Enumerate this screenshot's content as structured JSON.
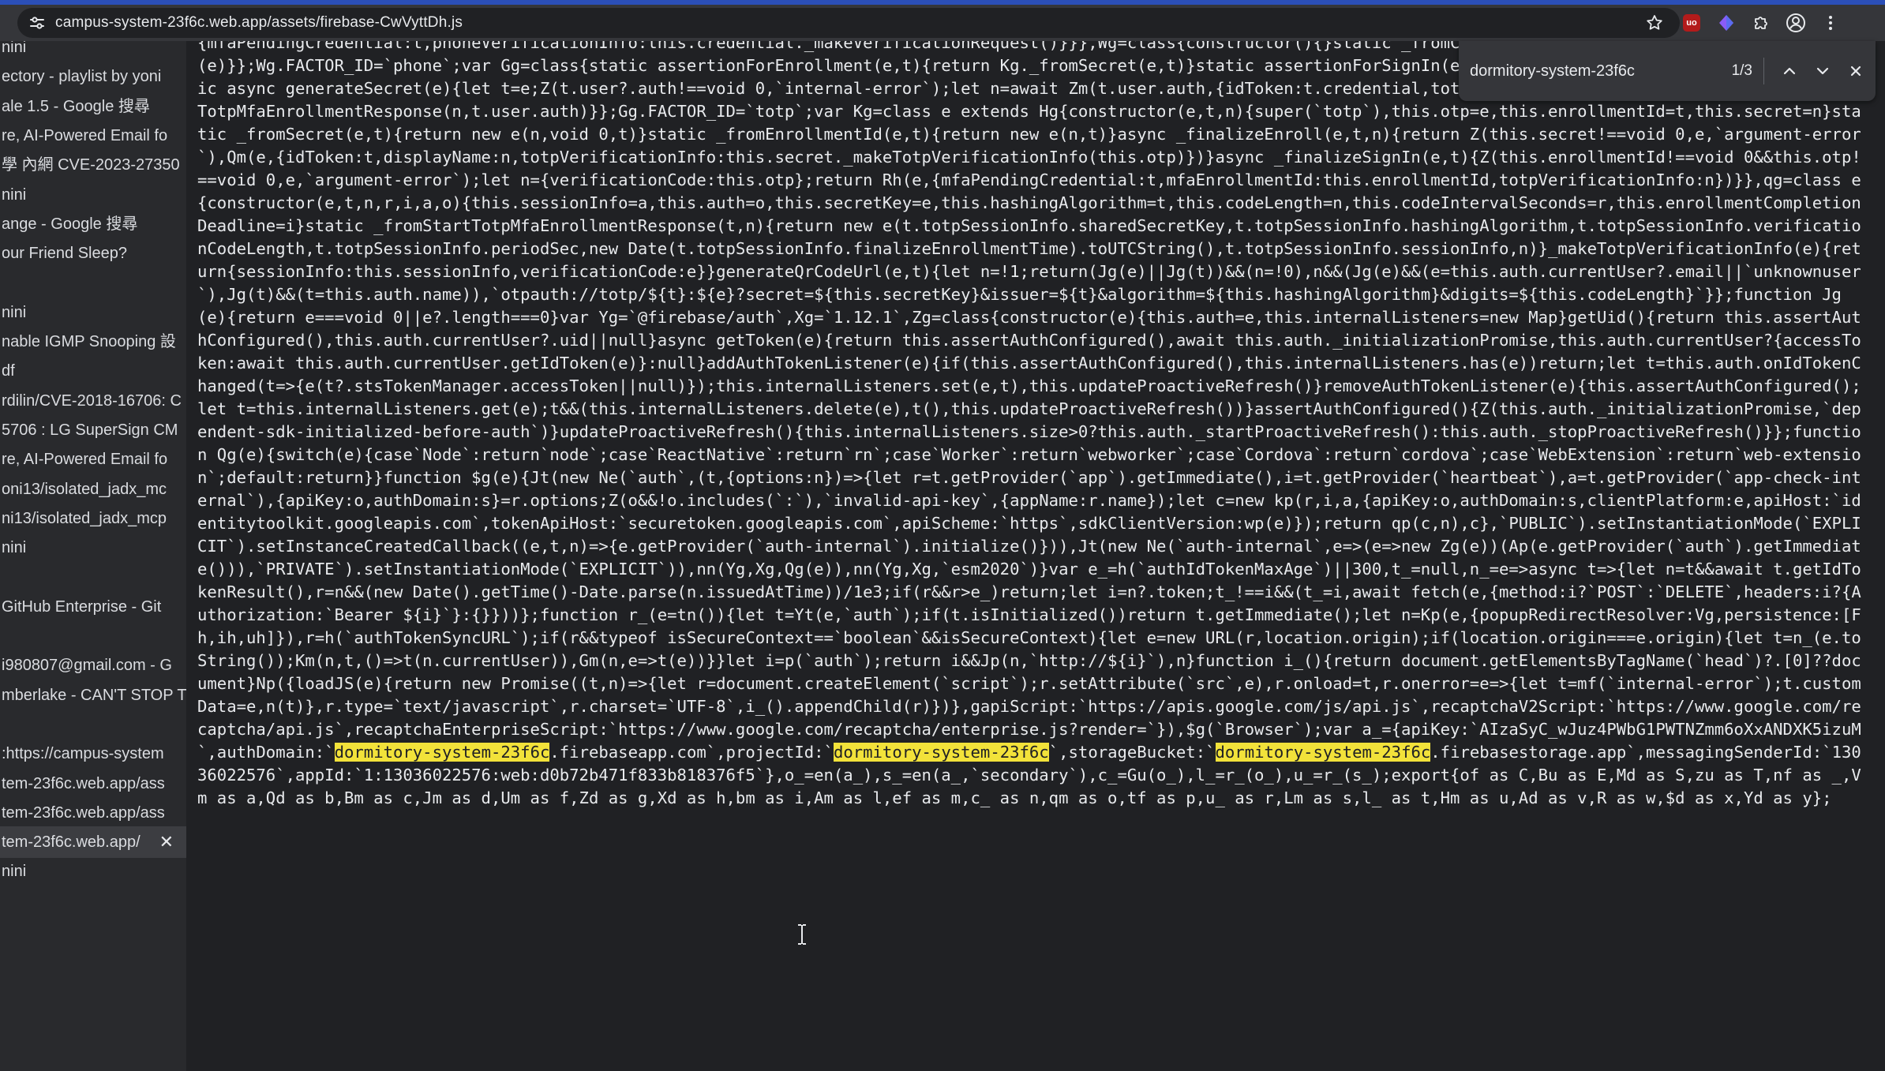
{
  "browser": {
    "url": "campus-system-23f6c.web.app/assets/firebase-CwVyttDh.js"
  },
  "find": {
    "query": "dormitory-system-23f6c",
    "count": "1/3"
  },
  "tabs": [
    {
      "label": "nini",
      "top": 0
    },
    {
      "label": "ectory - playlist by yoni",
      "top": 0
    },
    {
      "label": "ale 1.5 - Google 搜尋",
      "top": 0
    },
    {
      "label": "re, AI-Powered Email fo",
      "top": 0
    },
    {
      "label": "學 內網 CVE-2023-27350",
      "top": 0
    },
    {
      "label": "nini",
      "top": 0
    },
    {
      "label": "ange - Google 搜尋",
      "top": 0
    },
    {
      "label": "our Friend Sleep?",
      "top": 0
    },
    {
      "label": "",
      "top": 0
    },
    {
      "label": "nini",
      "top": 0
    },
    {
      "label": "nable IGMP Snooping 設",
      "top": 0
    },
    {
      "label": "df",
      "top": 0
    },
    {
      "label": "rdilin/CVE-2018-16706: C",
      "top": 0
    },
    {
      "label": "5706 : LG SuperSign CM",
      "top": 0
    },
    {
      "label": "re, AI-Powered Email fo",
      "top": 0
    },
    {
      "label": "oni13/isolated_jadx_mc",
      "top": 0
    },
    {
      "label": "ni13/isolated_jadx_mcp",
      "top": 0
    },
    {
      "label": "nini",
      "top": 0
    },
    {
      "label": "",
      "top": 0
    },
    {
      "label": " GitHub Enterprise - Git",
      "top": 0
    },
    {
      "label": "",
      "top": 0
    },
    {
      "label": "i980807@gmail.com - G",
      "top": 0
    },
    {
      "label": "mberlake - CAN'T STOP T",
      "top": 0
    },
    {
      "label": "",
      "top": 0
    },
    {
      "label": ":https://campus-system",
      "top": 0
    },
    {
      "label": "tem-23f6c.web.app/ass",
      "top": 0
    },
    {
      "label": "tem-23f6c.web.app/ass",
      "top": 0
    },
    {
      "label": "tem-23f6c.web.app/",
      "top": 0
    },
    {
      "label": "nini",
      "top": 0
    }
  ],
  "tab_close_glyph": "✕",
  "code": {
    "before": "{mfaPendingCredential:t,phoneVerificationInfo:this.credential._makeVerificationRequest()}}},Wg=class{constructor(){}static _fromCredential(e){return Ug._fromCredential(e)}};Wg.FACTOR_ID=`phone`;var Gg=class{static assertionForEnrollment(e,t){return Kg._fromSecret(e,t)}static assertionForSignIn(e,t){return Kg._fromEnrollmentId(e,t)}static async generateSecret(e){let t=e;Z(t.user?.auth!==void 0,`internal-error`);let n=await Zm(t.user.auth,{idToken:t.credential,totpEnrollmentInfo:{}});return qg._fromStartTotpMfaEnrollmentResponse(n,t.user.auth)}};Gg.FACTOR_ID=`totp`;var Kg=class e extends Hg{constructor(e,t,n){super(`totp`),this.otp=e,this.enrollmentId=t,this.secret=n}static _fromSecret(e,t){return new e(n,void 0,t)}static _fromEnrollmentId(e,t){return new e(n,t)}async _finalizeEnroll(e,t,n){return Z(this.secret!==void 0,e,`argument-error`),Qm(e,{idToken:t,displayName:n,totpVerificationInfo:this.secret._makeTotpVerificationInfo(this.otp)})}async _finalizeSignIn(e,t){Z(this.enrollmentId!==void 0&&this.otp!==void 0,e,`argument-error`);let n={verificationCode:this.otp};return Rh(e,{mfaPendingCredential:t,mfaEnrollmentId:this.enrollmentId,totpVerificationInfo:n})}},qg=class e{constructor(e,t,n,r,i,a,o){this.sessionInfo=a,this.auth=o,this.secretKey=e,this.hashingAlgorithm=t,this.codeLength=n,this.codeIntervalSeconds=r,this.enrollmentCompletionDeadline=i}static _fromStartTotpMfaEnrollmentResponse(t,n){return new e(t.totpSessionInfo.sharedSecretKey,t.totpSessionInfo.hashingAlgorithm,t.totpSessionInfo.verificationCodeLength,t.totpSessionInfo.periodSec,new Date(t.totpSessionInfo.finalizeEnrollmentTime).toUTCString(),t.totpSessionInfo.sessionInfo,n)}_makeTotpVerificationInfo(e){return{sessionInfo:this.sessionInfo,verificationCode:e}}generateQrCodeUrl(e,t){let n=!1;return(Jg(e)||Jg(t))&&(n=!0),n&&(Jg(e)&&(e=this.auth.currentUser?.email||`unknownuser`),Jg(t)&&(t=this.auth.name)),`otpauth://totp/${t}:${e}?secret=${this.secretKey}&issuer=${t}&algorithm=${this.hashingAlgorithm}&digits=${this.codeLength}`}};function Jg(e){return e===void 0||e?.length===0}var Yg=`@firebase/auth`,Xg=`1.12.1`,Zg=class{constructor(e){this.auth=e,this.internalListeners=new Map}getUid(){return this.assertAuthConfigured(),this.auth.currentUser?.uid||null}async getToken(e){return this.assertAuthConfigured(),await this.auth._initializationPromise,this.auth.currentUser?{accessToken:await this.auth.currentUser.getIdToken(e)}:null}addAuthTokenListener(e){if(this.assertAuthConfigured(),this.internalListeners.has(e))return;let t=this.auth.onIdTokenChanged(t=>{e(t?.stsTokenManager.accessToken||null)});this.internalListeners.set(e,t),this.updateProactiveRefresh()}removeAuthTokenListener(e){this.assertAuthConfigured();let t=this.internalListeners.get(e);t&&(this.internalListeners.delete(e),t(),this.updateProactiveRefresh())}assertAuthConfigured(){Z(this.auth._initializationPromise,`dependent-sdk-initialized-before-auth`)}updateProactiveRefresh(){this.internalListeners.size>0?this.auth._startProactiveRefresh():this.auth._stopProactiveRefresh()}};function Qg(e){switch(e){case`Node`:return`node`;case`ReactNative`:return`rn`;case`Worker`:return`webworker`;case`Cordova`:return`cordova`;case`WebExtension`:return`web-extension`;default:return}}function $g(e){Jt(new Ne(`auth`,(t,{options:n})=>{let r=t.getProvider(`app`).getImmediate(),i=t.getProvider(`heartbeat`),a=t.getProvider(`app-check-internal`),{apiKey:o,authDomain:s}=r.options;Z(o&&!o.includes(`:`),`invalid-api-key`,{appName:r.name});let c=new kp(r,i,a,{apiKey:o,authDomain:s,clientPlatform:e,apiHost:`identitytoolkit.googleapis.com`,tokenApiHost:`securetoken.googleapis.com`,apiScheme:`https`,sdkClientVersion:wp(e)});return qp(c,n),c},`PUBLIC`).setInstantiationMode(`EXPLICIT`).setInstanceCreatedCallback((e,t,n)=>{e.getProvider(`auth-internal`).initialize()})),Jt(new Ne(`auth-internal`,e=>(e=>new Zg(e))(Ap(e.getProvider(`auth`).getImmediate())),`PRIVATE`).setInstantiationMode(`EXPLICIT`)),nn(Yg,Xg,Qg(e)),nn(Yg,Xg,`esm2020`)}var e_=h(`authIdTokenMaxAge`)||300,t_=null,n_=e=>async t=>{let n=t&&await t.getIdTokenResult(),r=n&&(new Date().getTime()-Date.parse(n.issuedAtTime))/1e3;if(r&&r>e_)return;let i=n?.token;t_!==i&&(t_=i,await fetch(e,{method:i?`POST`:`DELETE`,headers:i?{Authorization:`Bearer ${i}`}:{}}))};function r_(e=tn()){let t=Yt(e,`auth`);if(t.isInitialized())return t.getImmediate();let n=Kp(e,{popupRedirectResolver:Vg,persistence:[Fh,ih,uh]}),r=h(`authTokenSyncURL`);if(r&&typeof isSecureContext==`boolean`&&isSecureContext){let e=new URL(r,location.origin);if(location.origin===e.origin){let t=n_(e.toString());Km(n,t,()=>t(n.currentUser)),Gm(n,e=>t(e))}}let i=p(`auth`);return i&&Jp(n,`http://${i}`),n}function i_(){return document.getElementsByTagName(`head`)?.[0]??document}Np({loadJS(e){return new Promise((t,n)=>{let r=document.createElement(`script`);r.setAttribute(`src`,e),r.onload=t,r.onerror=e=>{let t=mf(`internal-error`);t.customData=e,n(t)},r.type=`text/javascript`,r.charset=`UTF-8`,i_().appendChild(r)})},gapiScript:`https://apis.google.com/js/api.js`,recaptchaV2Script:`https://www.google.com/recaptcha/api.js`,recaptchaEnterpriseScript:`https://www.google.com/recaptcha/enterprise.js?render=`}),$g(`Browser`);var a_={apiKey:`AIzaSyC_wJuz4PWbG1PWTNZmm6oXxANDXK5izuM`,authDomain:`",
    "match1": "dormitory-system-23f6c",
    "mid1": ".firebaseapp.com`,projectId:`",
    "match2": "dormitory-system-23f6c",
    "mid2": "`,storageBucket:`",
    "match3": "dormitory-system-23f6c",
    "after": ".firebasestorage.app`,messagingSenderId:`13036022576`,appId:`1:13036022576:web:d0b72b471f833b818376f5`},o_=en(a_),s_=en(a_,`secondary`),c_=Gu(o_),l_=r_(o_),u_=r_(s_);export{of as C,Bu as E,Md as S,zu as T,nf as _,Vm as a,Qd as b,Bm as c,Jm as d,Um as f,Zd as g,Xd as h,bm as i,Am as l,ef as m,c_ as n,qm as o,tf as p,u_ as r,Lm as s,l_ as t,Hm as u,Ad as v,R as w,$d as x,Yd as y};"
  }
}
